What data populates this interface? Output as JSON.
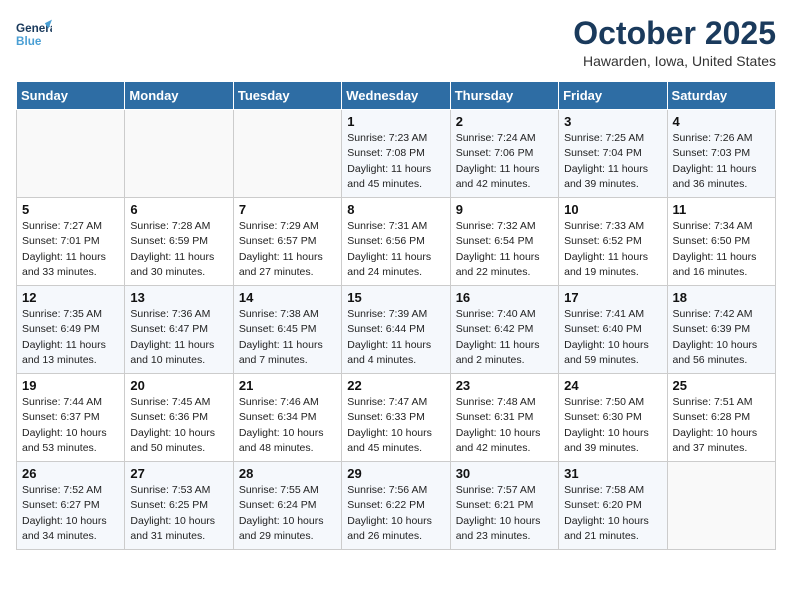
{
  "header": {
    "logo_line1": "General",
    "logo_line2": "Blue",
    "month_title": "October 2025",
    "location": "Hawarden, Iowa, United States"
  },
  "days_of_week": [
    "Sunday",
    "Monday",
    "Tuesday",
    "Wednesday",
    "Thursday",
    "Friday",
    "Saturday"
  ],
  "weeks": [
    [
      {
        "day": "",
        "sunrise": "",
        "sunset": "",
        "daylight": ""
      },
      {
        "day": "",
        "sunrise": "",
        "sunset": "",
        "daylight": ""
      },
      {
        "day": "",
        "sunrise": "",
        "sunset": "",
        "daylight": ""
      },
      {
        "day": "1",
        "sunrise": "Sunrise: 7:23 AM",
        "sunset": "Sunset: 7:08 PM",
        "daylight": "Daylight: 11 hours and 45 minutes."
      },
      {
        "day": "2",
        "sunrise": "Sunrise: 7:24 AM",
        "sunset": "Sunset: 7:06 PM",
        "daylight": "Daylight: 11 hours and 42 minutes."
      },
      {
        "day": "3",
        "sunrise": "Sunrise: 7:25 AM",
        "sunset": "Sunset: 7:04 PM",
        "daylight": "Daylight: 11 hours and 39 minutes."
      },
      {
        "day": "4",
        "sunrise": "Sunrise: 7:26 AM",
        "sunset": "Sunset: 7:03 PM",
        "daylight": "Daylight: 11 hours and 36 minutes."
      }
    ],
    [
      {
        "day": "5",
        "sunrise": "Sunrise: 7:27 AM",
        "sunset": "Sunset: 7:01 PM",
        "daylight": "Daylight: 11 hours and 33 minutes."
      },
      {
        "day": "6",
        "sunrise": "Sunrise: 7:28 AM",
        "sunset": "Sunset: 6:59 PM",
        "daylight": "Daylight: 11 hours and 30 minutes."
      },
      {
        "day": "7",
        "sunrise": "Sunrise: 7:29 AM",
        "sunset": "Sunset: 6:57 PM",
        "daylight": "Daylight: 11 hours and 27 minutes."
      },
      {
        "day": "8",
        "sunrise": "Sunrise: 7:31 AM",
        "sunset": "Sunset: 6:56 PM",
        "daylight": "Daylight: 11 hours and 24 minutes."
      },
      {
        "day": "9",
        "sunrise": "Sunrise: 7:32 AM",
        "sunset": "Sunset: 6:54 PM",
        "daylight": "Daylight: 11 hours and 22 minutes."
      },
      {
        "day": "10",
        "sunrise": "Sunrise: 7:33 AM",
        "sunset": "Sunset: 6:52 PM",
        "daylight": "Daylight: 11 hours and 19 minutes."
      },
      {
        "day": "11",
        "sunrise": "Sunrise: 7:34 AM",
        "sunset": "Sunset: 6:50 PM",
        "daylight": "Daylight: 11 hours and 16 minutes."
      }
    ],
    [
      {
        "day": "12",
        "sunrise": "Sunrise: 7:35 AM",
        "sunset": "Sunset: 6:49 PM",
        "daylight": "Daylight: 11 hours and 13 minutes."
      },
      {
        "day": "13",
        "sunrise": "Sunrise: 7:36 AM",
        "sunset": "Sunset: 6:47 PM",
        "daylight": "Daylight: 11 hours and 10 minutes."
      },
      {
        "day": "14",
        "sunrise": "Sunrise: 7:38 AM",
        "sunset": "Sunset: 6:45 PM",
        "daylight": "Daylight: 11 hours and 7 minutes."
      },
      {
        "day": "15",
        "sunrise": "Sunrise: 7:39 AM",
        "sunset": "Sunset: 6:44 PM",
        "daylight": "Daylight: 11 hours and 4 minutes."
      },
      {
        "day": "16",
        "sunrise": "Sunrise: 7:40 AM",
        "sunset": "Sunset: 6:42 PM",
        "daylight": "Daylight: 11 hours and 2 minutes."
      },
      {
        "day": "17",
        "sunrise": "Sunrise: 7:41 AM",
        "sunset": "Sunset: 6:40 PM",
        "daylight": "Daylight: 10 hours and 59 minutes."
      },
      {
        "day": "18",
        "sunrise": "Sunrise: 7:42 AM",
        "sunset": "Sunset: 6:39 PM",
        "daylight": "Daylight: 10 hours and 56 minutes."
      }
    ],
    [
      {
        "day": "19",
        "sunrise": "Sunrise: 7:44 AM",
        "sunset": "Sunset: 6:37 PM",
        "daylight": "Daylight: 10 hours and 53 minutes."
      },
      {
        "day": "20",
        "sunrise": "Sunrise: 7:45 AM",
        "sunset": "Sunset: 6:36 PM",
        "daylight": "Daylight: 10 hours and 50 minutes."
      },
      {
        "day": "21",
        "sunrise": "Sunrise: 7:46 AM",
        "sunset": "Sunset: 6:34 PM",
        "daylight": "Daylight: 10 hours and 48 minutes."
      },
      {
        "day": "22",
        "sunrise": "Sunrise: 7:47 AM",
        "sunset": "Sunset: 6:33 PM",
        "daylight": "Daylight: 10 hours and 45 minutes."
      },
      {
        "day": "23",
        "sunrise": "Sunrise: 7:48 AM",
        "sunset": "Sunset: 6:31 PM",
        "daylight": "Daylight: 10 hours and 42 minutes."
      },
      {
        "day": "24",
        "sunrise": "Sunrise: 7:50 AM",
        "sunset": "Sunset: 6:30 PM",
        "daylight": "Daylight: 10 hours and 39 minutes."
      },
      {
        "day": "25",
        "sunrise": "Sunrise: 7:51 AM",
        "sunset": "Sunset: 6:28 PM",
        "daylight": "Daylight: 10 hours and 37 minutes."
      }
    ],
    [
      {
        "day": "26",
        "sunrise": "Sunrise: 7:52 AM",
        "sunset": "Sunset: 6:27 PM",
        "daylight": "Daylight: 10 hours and 34 minutes."
      },
      {
        "day": "27",
        "sunrise": "Sunrise: 7:53 AM",
        "sunset": "Sunset: 6:25 PM",
        "daylight": "Daylight: 10 hours and 31 minutes."
      },
      {
        "day": "28",
        "sunrise": "Sunrise: 7:55 AM",
        "sunset": "Sunset: 6:24 PM",
        "daylight": "Daylight: 10 hours and 29 minutes."
      },
      {
        "day": "29",
        "sunrise": "Sunrise: 7:56 AM",
        "sunset": "Sunset: 6:22 PM",
        "daylight": "Daylight: 10 hours and 26 minutes."
      },
      {
        "day": "30",
        "sunrise": "Sunrise: 7:57 AM",
        "sunset": "Sunset: 6:21 PM",
        "daylight": "Daylight: 10 hours and 23 minutes."
      },
      {
        "day": "31",
        "sunrise": "Sunrise: 7:58 AM",
        "sunset": "Sunset: 6:20 PM",
        "daylight": "Daylight: 10 hours and 21 minutes."
      },
      {
        "day": "",
        "sunrise": "",
        "sunset": "",
        "daylight": ""
      }
    ]
  ]
}
